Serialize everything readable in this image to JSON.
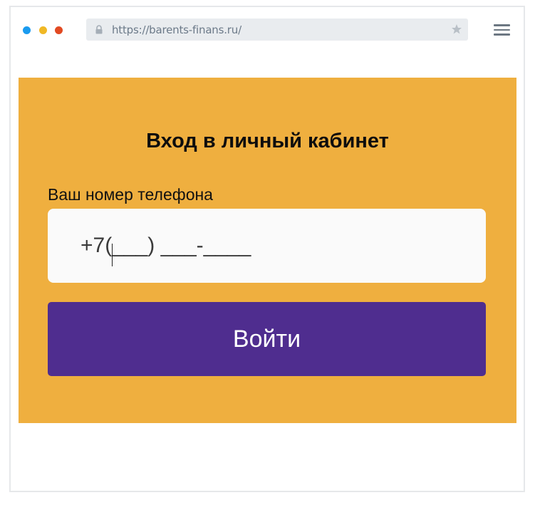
{
  "browser": {
    "url": "https://barents-finans.ru/",
    "traffic_lights": [
      "#1a9bef",
      "#f0b825",
      "#e24a22"
    ],
    "icons": {
      "lock": "lock-icon",
      "bookmark": "star-icon",
      "menu": "hamburger-menu-icon"
    }
  },
  "login": {
    "title": "Вход в личный кабинет",
    "phone_label": "Ваш номер телефона",
    "phone_value": "+7(___) ___-____",
    "submit_label": "Войти"
  },
  "colors": {
    "panel_background": "#efaf3f",
    "button_background": "#4f2d8f",
    "input_background": "#fafafa"
  }
}
